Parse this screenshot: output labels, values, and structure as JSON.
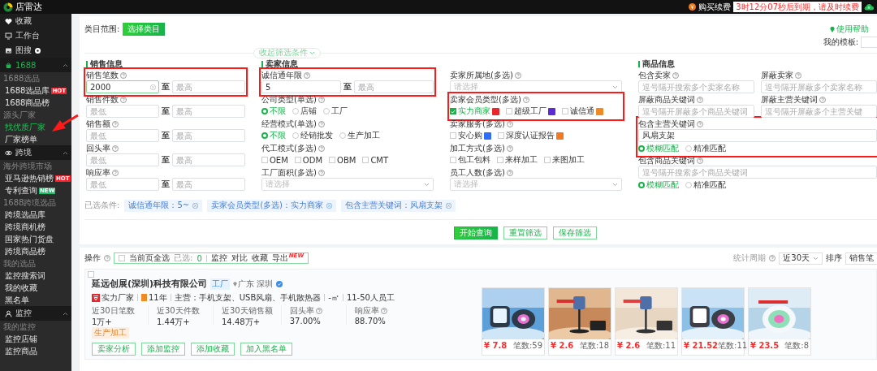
{
  "top_bar": {
    "logo": "店雷达",
    "renew": "购买续费",
    "expiry": "3时12分07秒后到期，请及时续费"
  },
  "sidebar": {
    "top_items": [
      {
        "label": "收藏"
      },
      {
        "label": "工作台"
      },
      {
        "label": "图搜",
        "dot": true
      }
    ],
    "sections": [
      {
        "label": "1688",
        "active": true,
        "expanded": true,
        "groups": [
          {
            "label": "1688选品",
            "items": [
              {
                "label": "1688选品库",
                "selected": false,
                "badge": {
                  "text": "HOT",
                  "kind": "hot"
                }
              },
              {
                "label": "1688商品榜",
                "selected": false
              }
            ]
          },
          {
            "label": "源头厂家",
            "items": [
              {
                "label": "找优质厂家",
                "selected": true
              },
              {
                "label": "厂家榜单",
                "selected": false
              }
            ]
          }
        ]
      },
      {
        "label": "跨境",
        "active": false,
        "expanded": true,
        "groups": [
          {
            "label": "海外跨境市场",
            "items": [
              {
                "label": "亚马逊热销榜",
                "selected": false,
                "badge": {
                  "text": "HOT",
                  "kind": "hot"
                }
              },
              {
                "label": "专利查询",
                "selected": false,
                "badge": {
                  "text": "NEW",
                  "kind": "new"
                }
              }
            ]
          },
          {
            "label": "1688跨境选品",
            "items": [
              {
                "label": "跨境选品库",
                "selected": false
              },
              {
                "label": "跨境商机榜",
                "selected": false
              },
              {
                "label": "国家热门货盘",
                "selected": false
              },
              {
                "label": "跨境商品榜",
                "selected": false
              }
            ]
          },
          {
            "label": "我的选品",
            "items": [
              {
                "label": "监控搜索词",
                "selected": false
              },
              {
                "label": "我的收藏",
                "selected": false
              },
              {
                "label": "黑名单",
                "selected": false
              }
            ]
          }
        ]
      },
      {
        "label": "监控",
        "active": false,
        "expanded": true,
        "groups": [
          {
            "label": "我的监控",
            "items": [
              {
                "label": "监控店铺",
                "selected": false
              },
              {
                "label": "监控商品",
                "selected": false
              }
            ]
          }
        ]
      }
    ]
  },
  "filter": {
    "category": {
      "label": "类目范围:",
      "button": "选择类目"
    },
    "help_link": "使用帮助",
    "template": {
      "label": "我的模板:"
    },
    "collapse": "收起筛选条件",
    "columns": [
      {
        "title": "销售信息",
        "kind": "stack",
        "fields": [
          {
            "kind": "range",
            "label": "销售笔数",
            "help": true,
            "highlighted": true,
            "min": {
              "value": "2000",
              "clearable": true
            },
            "separator": "至",
            "max": {
              "placeholder": "最高"
            }
          },
          {
            "kind": "range",
            "label": "销售件数",
            "help": true,
            "min": {
              "placeholder": "最低"
            },
            "separator": "至",
            "max": {
              "placeholder": "最高"
            }
          },
          {
            "kind": "range",
            "label": "销售额",
            "help": true,
            "min": {
              "placeholder": "最低"
            },
            "separator": "至",
            "max": {
              "placeholder": "最高"
            }
          },
          {
            "kind": "range",
            "label": "回头率",
            "help": true,
            "min": {
              "placeholder": "最低"
            },
            "separator": "至",
            "max": {
              "placeholder": "最高"
            }
          },
          {
            "kind": "range",
            "label": "响应率",
            "help": true,
            "min": {
              "placeholder": "最低"
            },
            "separator": "至",
            "max": {
              "placeholder": "最高"
            }
          }
        ]
      },
      {
        "title": "卖家信息",
        "kind": "stack",
        "fields": [
          {
            "kind": "range",
            "label": "诚信通年限",
            "help": true,
            "highlighted": true,
            "min": {
              "value": "5"
            },
            "separator": "至",
            "max": {
              "placeholder": "最高"
            }
          },
          {
            "kind": "radio",
            "label": "公司类型(单选)",
            "help": true,
            "options": [
              {
                "label": "不限",
                "selected": true
              },
              {
                "label": "店铺",
                "selected": false
              },
              {
                "label": "工厂",
                "selected": false
              }
            ]
          },
          {
            "kind": "radio",
            "label": "经营模式(单选)",
            "help": true,
            "options": [
              {
                "label": "不限",
                "selected": true
              },
              {
                "label": "经销批发",
                "selected": false
              },
              {
                "label": "生产加工",
                "selected": false
              }
            ]
          },
          {
            "kind": "checkbox",
            "label": "代工模式(多选)",
            "help": true,
            "options": [
              {
                "label": "OEM",
                "checked": false
              },
              {
                "label": "ODM",
                "checked": false
              },
              {
                "label": "OBM",
                "checked": false
              },
              {
                "label": "CMT",
                "checked": false
              }
            ]
          },
          {
            "kind": "select",
            "label": "工厂面积(多选)",
            "help": true,
            "placeholder": "请选择"
          }
        ]
      },
      {
        "kind": "stack",
        "fields": [
          {
            "kind": "select",
            "label": "卖家所属地(多选)",
            "help": true,
            "placeholder": "请选择"
          },
          {
            "kind": "checkbox",
            "label": "卖家会员类型(多选)",
            "help": true,
            "highlighted": true,
            "options": [
              {
                "label": "实力商家",
                "checked": true,
                "color": "#e8262b"
              },
              {
                "label": "超级工厂",
                "checked": false,
                "color": "#5b2bd6"
              },
              {
                "label": "诚信通",
                "checked": false,
                "color": "#f08a24"
              }
            ]
          },
          {
            "kind": "checkbox",
            "label": "卖家服务(多选)",
            "help": true,
            "options": [
              {
                "label": "安心购",
                "checked": false,
                "color": "#2f6df6"
              },
              {
                "label": "深度认证报告",
                "checked": false,
                "color": "#f07a24"
              }
            ]
          },
          {
            "kind": "checkbox",
            "label": "加工方式(多选)",
            "help": true,
            "options": [
              {
                "label": "包工包料",
                "checked": false
              },
              {
                "label": "来样加工",
                "checked": false
              },
              {
                "label": "来图加工",
                "checked": false
              }
            ]
          },
          {
            "kind": "select",
            "label": "员工人数(多选)",
            "help": true,
            "placeholder": "请选择"
          }
        ]
      },
      {
        "title": "商品信息",
        "kind": "grid",
        "fields": [
          {
            "kind": "text",
            "label": "包含卖家",
            "help": true,
            "placeholder": "逗号隔开搜索多个卖家名称"
          },
          {
            "kind": "text",
            "label": "屏蔽卖家",
            "help": true,
            "placeholder": "逗号隔开屏蔽多个卖家名称"
          },
          {
            "kind": "text",
            "label": "屏蔽商品关键词",
            "help": true,
            "placeholder": "逗号隔开屏蔽多个商品关键词"
          },
          {
            "kind": "text",
            "label": "屏蔽主营关键词",
            "help": true,
            "placeholder": "逗号隔开屏蔽多个主营关键"
          },
          {
            "kind": "text",
            "label": "包含主营关键词",
            "help": true,
            "wide": true,
            "highlighted": true,
            "value": "风扇支架",
            "match": [
              {
                "label": "模糊匹配",
                "selected": true
              },
              {
                "label": "精准匹配",
                "selected": false
              }
            ]
          },
          {
            "kind": "text",
            "label": "包含商品关键词",
            "help": true,
            "wide": true,
            "placeholder": "逗号隔开搜索多个商品关键词",
            "match": [
              {
                "label": "模糊匹配",
                "selected": true
              },
              {
                "label": "精准匹配",
                "selected": false
              }
            ]
          }
        ]
      }
    ],
    "selected_conditions": {
      "label": "已选条件:",
      "chips": [
        "诚信通年限：5~",
        "卖家会员类型(多选)：实力商家",
        "包含主营关键词：风扇支架"
      ]
    },
    "actions": [
      {
        "label": "开始查询",
        "primary": true
      },
      {
        "label": "重置筛选",
        "primary": false
      },
      {
        "label": "保存筛选",
        "primary": false
      }
    ]
  },
  "results": {
    "toolbar": {
      "label": "操作",
      "select_all": {
        "label": "当前页全选",
        "checked": false
      },
      "selected_label": "已选:",
      "selected_count": "0",
      "actions": [
        {
          "label": "监控"
        },
        {
          "label": "对比"
        },
        {
          "label": "收藏"
        },
        {
          "label": "导出",
          "badge": "NEW"
        }
      ]
    },
    "period": {
      "label": "统计周期",
      "value": "近30天"
    },
    "sort": {
      "label": "排序",
      "value": "销售笔"
    },
    "cards": [
      {
        "selected": false,
        "name": "延远创展(深圳)科技有限公司",
        "type_tag": "工厂",
        "location": "广东 深圳",
        "verified": true,
        "facts": [
          {
            "kind": "strength",
            "text": "实力厂家"
          },
          {
            "kind": "years",
            "text": "11年"
          },
          {
            "kind": "text",
            "text": "主营：手机支架、USB风扇、手机散热器"
          },
          {
            "kind": "text",
            "text": "-㎡"
          },
          {
            "kind": "text",
            "text": "11-50人员工"
          }
        ],
        "stats": [
          {
            "label": "近30日笔数",
            "value": "1万+"
          },
          {
            "label": "近30天件数",
            "value": "1.44万+"
          },
          {
            "label": "近30天销售额",
            "value": "14.48万+"
          },
          {
            "label": "回头率",
            "value": "37.00%",
            "help": true
          },
          {
            "label": "响应率",
            "value": "88.70%",
            "help": true
          }
        ],
        "tags": [
          "生产加工"
        ],
        "buttons": [
          "卖家分析",
          "添加监控",
          "添加收藏",
          "加入黑名单"
        ],
        "products": [
          {
            "price": "¥ 7.8",
            "sales": "笔数:59"
          },
          {
            "price": "¥ 2.6",
            "sales": "笔数:18"
          },
          {
            "price": "¥ 2.6",
            "sales": "笔数:11"
          },
          {
            "price": "¥ 21.52",
            "sales": "笔数:11"
          },
          {
            "price": "¥ 23.5",
            "sales": "笔数:8"
          }
        ]
      }
    ]
  }
}
